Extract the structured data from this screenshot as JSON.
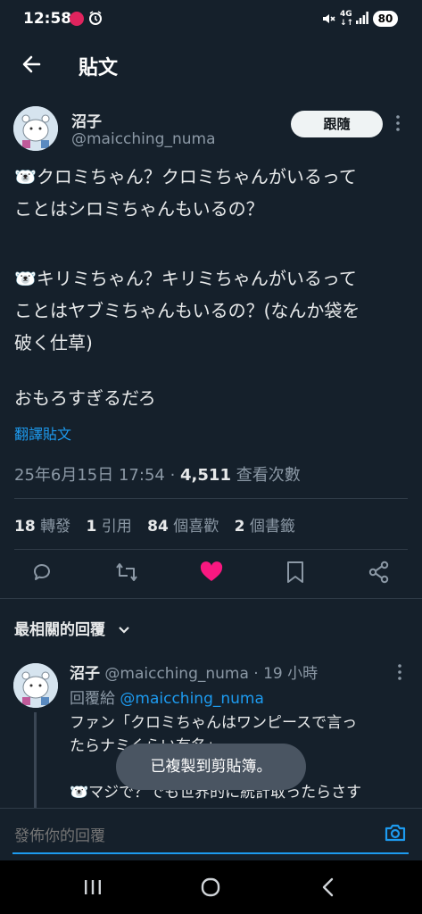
{
  "status_bar": {
    "time": "12:58",
    "battery": "80"
  },
  "header": {
    "title": "貼文"
  },
  "tweet": {
    "author_name": "沼子",
    "author_handle": "@maicching_numa",
    "follow_label": "跟隨",
    "lines": [
      "🐻‍❄️クロミちゃん？クロミちゃんがいるって",
      "ことはシロミちゃんもいるの？",
      "",
      "🐻‍❄️キリミちゃん？キリミちゃんがいるって",
      "ことはヤブミちゃんもいるの？(なんか袋を",
      "破く仕草)",
      "",
      "おもろすぎるだろ"
    ],
    "translate_label": "翻譯貼文",
    "timestamp": "25年6月15日 17:54 · ",
    "views_count": "4,511",
    "views_label": " 查看次數"
  },
  "stats": {
    "reposts_count": "18",
    "reposts_label": " 轉發",
    "quotes_count": "1",
    "quotes_label": " 引用",
    "likes_count": "84",
    "likes_label": " 個喜歡",
    "bookmarks_count": "2",
    "bookmarks_label": " 個書籤"
  },
  "replies_filter": {
    "label": "最相關的回覆"
  },
  "reply": {
    "author_name": "沼子",
    "author_handle": "@maicching_numa",
    "time": " · 19 小時",
    "replying_to_label": "回覆給 ",
    "replying_to_handle": "@maicching_numa",
    "lines": [
      "ファン「クロミちゃんはワンピースで言っ",
      "たらナミくらい有名」",
      "",
      "🐻‍❄️マジで？でも世界的に統計取ったらさす"
    ]
  },
  "toast": {
    "text": "已複製到剪貼簿。"
  },
  "compose": {
    "placeholder": "發佈你的回覆"
  },
  "colors": {
    "background": "#15202b",
    "accent": "#1d9bf0",
    "like": "#f91880"
  }
}
